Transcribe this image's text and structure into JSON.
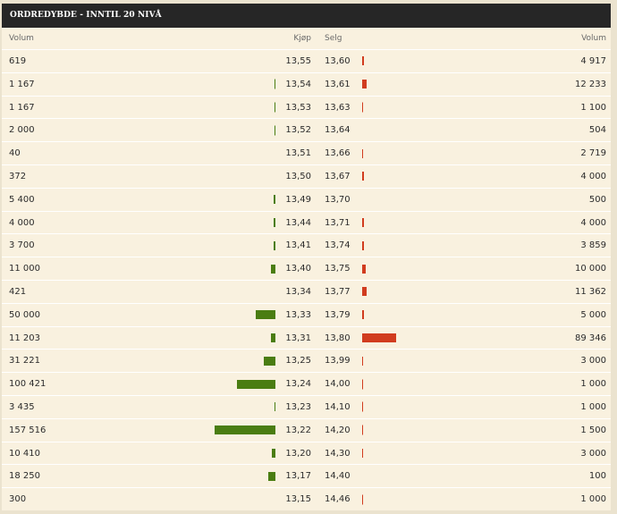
{
  "title": "ORDREDYBDE - INNTIL 20 NIVÅ",
  "columns": {
    "buy_volume": "Volum",
    "buy_price": "Kjøp",
    "sell_price": "Selg",
    "sell_volume": "Volum"
  },
  "colors": {
    "buy_bar": "#4a7d12",
    "sell_bar": "#d13c1f",
    "header_bg": "#262626",
    "panel_bg": "#f9f1df"
  },
  "rows": [
    {
      "buy_volume": "619",
      "buy_price": "13,55",
      "sell_price": "13,60",
      "sell_volume": "4 917"
    },
    {
      "buy_volume": "1 167",
      "buy_price": "13,54",
      "sell_price": "13,61",
      "sell_volume": "12 233"
    },
    {
      "buy_volume": "1 167",
      "buy_price": "13,53",
      "sell_price": "13,63",
      "sell_volume": "1 100"
    },
    {
      "buy_volume": "2 000",
      "buy_price": "13,52",
      "sell_price": "13,64",
      "sell_volume": "504"
    },
    {
      "buy_volume": "40",
      "buy_price": "13,51",
      "sell_price": "13,66",
      "sell_volume": "2 719"
    },
    {
      "buy_volume": "372",
      "buy_price": "13,50",
      "sell_price": "13,67",
      "sell_volume": "4 000"
    },
    {
      "buy_volume": "5 400",
      "buy_price": "13,49",
      "sell_price": "13,70",
      "sell_volume": "500"
    },
    {
      "buy_volume": "4 000",
      "buy_price": "13,44",
      "sell_price": "13,71",
      "sell_volume": "4 000"
    },
    {
      "buy_volume": "3 700",
      "buy_price": "13,41",
      "sell_price": "13,74",
      "sell_volume": "3 859"
    },
    {
      "buy_volume": "11 000",
      "buy_price": "13,40",
      "sell_price": "13,75",
      "sell_volume": "10 000"
    },
    {
      "buy_volume": "421",
      "buy_price": "13,34",
      "sell_price": "13,77",
      "sell_volume": "11 362"
    },
    {
      "buy_volume": "50 000",
      "buy_price": "13,33",
      "sell_price": "13,79",
      "sell_volume": "5 000"
    },
    {
      "buy_volume": "11 203",
      "buy_price": "13,31",
      "sell_price": "13,80",
      "sell_volume": "89 346"
    },
    {
      "buy_volume": "31 221",
      "buy_price": "13,25",
      "sell_price": "13,99",
      "sell_volume": "3 000"
    },
    {
      "buy_volume": "100 421",
      "buy_price": "13,24",
      "sell_price": "14,00",
      "sell_volume": "1 000"
    },
    {
      "buy_volume": "3 435",
      "buy_price": "13,23",
      "sell_price": "14,10",
      "sell_volume": "1 000"
    },
    {
      "buy_volume": "157 516",
      "buy_price": "13,22",
      "sell_price": "14,20",
      "sell_volume": "1 500"
    },
    {
      "buy_volume": "10 410",
      "buy_price": "13,20",
      "sell_price": "14,30",
      "sell_volume": "3 000"
    },
    {
      "buy_volume": "18 250",
      "buy_price": "13,17",
      "sell_price": "14,40",
      "sell_volume": "100"
    },
    {
      "buy_volume": "300",
      "buy_price": "13,15",
      "sell_price": "14,46",
      "sell_volume": "1 000"
    }
  ]
}
